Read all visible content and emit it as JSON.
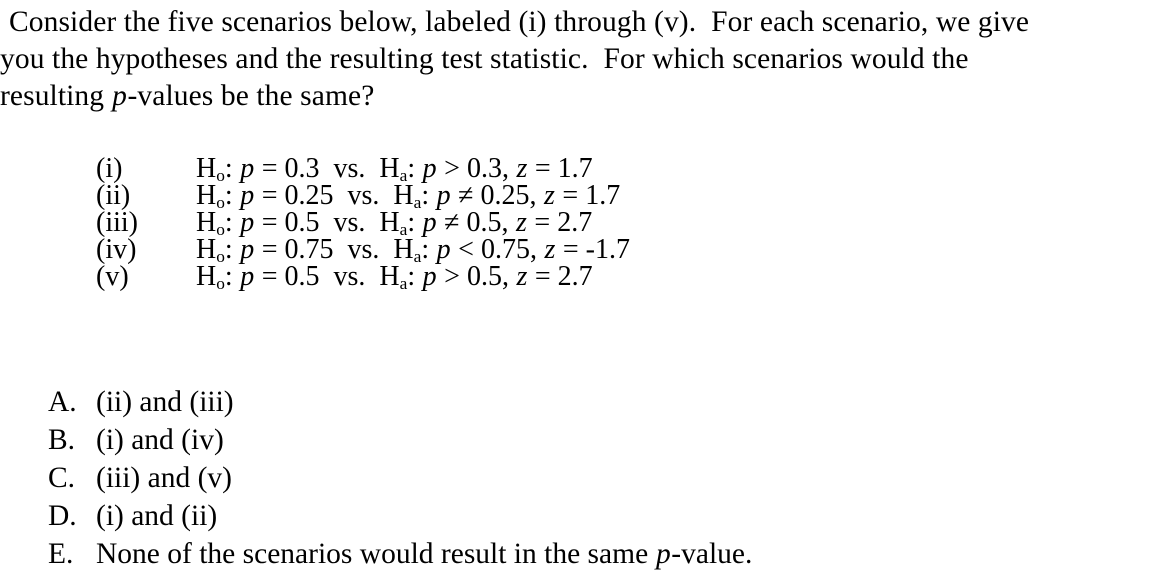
{
  "question": {
    "lines": [
      "Consider the five scenarios below, labeled (i) through (v).  For each scenario, we give",
      "you the hypotheses and the resulting test statistic.  For which scenarios would the",
      "resulting "
    ],
    "line3_italic_var": "p",
    "line3_tail": "-values be the same?"
  },
  "scenarios": [
    {
      "label": "(i)",
      "null_symbol": "H",
      "null_sub": "o",
      "null_colon": ": ",
      "param": "p",
      "null_rel": " = ",
      "null_value": "0.3",
      "vs": "  vs.  ",
      "alt_symbol": "H",
      "alt_sub": "a",
      "alt_colon": ": ",
      "alt_rel": " > ",
      "alt_value": "0.3",
      "stat_sep": ", ",
      "stat_var": "z",
      "stat_rel": " = ",
      "stat_value": "1.7"
    },
    {
      "label": "(ii)",
      "null_symbol": "H",
      "null_sub": "o",
      "null_colon": ": ",
      "param": "p",
      "null_rel": " = ",
      "null_value": "0.25",
      "vs": "  vs.  ",
      "alt_symbol": "H",
      "alt_sub": "a",
      "alt_colon": ": ",
      "alt_rel": " ≠ ",
      "alt_value": "0.25",
      "stat_sep": ", ",
      "stat_var": "z",
      "stat_rel": " = ",
      "stat_value": "1.7"
    },
    {
      "label": "(iii)",
      "null_symbol": "H",
      "null_sub": "o",
      "null_colon": ": ",
      "param": "p",
      "null_rel": " = ",
      "null_value": "0.5",
      "vs": "  vs.  ",
      "alt_symbol": "H",
      "alt_sub": "a",
      "alt_colon": ": ",
      "alt_rel": " ≠ ",
      "alt_value": "0.5",
      "stat_sep": ", ",
      "stat_var": "z",
      "stat_rel": " = ",
      "stat_value": "2.7"
    },
    {
      "label": "(iv)",
      "null_symbol": "H",
      "null_sub": "o",
      "null_colon": ": ",
      "param": "p",
      "null_rel": " = ",
      "null_value": "0.75",
      "vs": "  vs.  ",
      "alt_symbol": "H",
      "alt_sub": "a",
      "alt_colon": ": ",
      "alt_rel": " < ",
      "alt_value": "0.75",
      "stat_sep": ", ",
      "stat_var": "z",
      "stat_rel": " = ",
      "stat_value": "-1.7"
    },
    {
      "label": "(v)",
      "null_symbol": "H",
      "null_sub": "o",
      "null_colon": ": ",
      "param": "p",
      "null_rel": " = ",
      "null_value": "0.5",
      "vs": "  vs.  ",
      "alt_symbol": "H",
      "alt_sub": "a",
      "alt_colon": ": ",
      "alt_rel": " > ",
      "alt_value": "0.5",
      "stat_sep": ", ",
      "stat_var": "z",
      "stat_rel": " = ",
      "stat_value": "2.7"
    }
  ],
  "choices": [
    {
      "letter": "A.",
      "text": "(ii) and (iii)",
      "text_head": "(ii) and (iii)",
      "italic_var": "",
      "text_tail": ""
    },
    {
      "letter": "B.",
      "text": "(i) and (iv)",
      "text_head": "(i) and (iv)",
      "italic_var": "",
      "text_tail": ""
    },
    {
      "letter": "C.",
      "text": "(iii) and (v)",
      "text_head": "(iii) and (v)",
      "italic_var": "",
      "text_tail": ""
    },
    {
      "letter": "D.",
      "text": "(i) and (ii)",
      "text_head": "(i) and (ii)",
      "italic_var": "",
      "text_tail": ""
    },
    {
      "letter": "E.",
      "text": "None of the scenarios would result in the same p-value.",
      "text_head": "None of the scenarios would result in the same ",
      "italic_var": "p",
      "text_tail": "-value."
    }
  ],
  "colors": {
    "background": "#ffffff",
    "text": "#000000"
  }
}
